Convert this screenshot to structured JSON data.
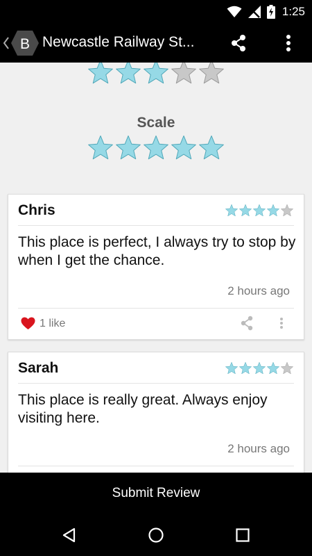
{
  "status_bar": {
    "time": "1:25",
    "icons": [
      "wifi-icon",
      "signal-icon",
      "battery-charging-icon"
    ]
  },
  "app_bar": {
    "logo_letter": "B",
    "title": "Newcastle Railway St...",
    "icons": [
      "back-chevron-icon",
      "share-icon",
      "more-vert-icon"
    ]
  },
  "ratings": {
    "top_rating": {
      "value": 3,
      "max": 5
    },
    "scale": {
      "label": "Scale",
      "value": 5,
      "max": 5
    }
  },
  "reviews": [
    {
      "name": "Chris",
      "rating": 4,
      "max_rating": 5,
      "text": "This place is perfect, I always try to stop by when I get the chance.",
      "time": "2 hours ago",
      "likes": "1 like"
    },
    {
      "name": "Sarah",
      "rating": 4,
      "max_rating": 5,
      "text": "This place is really great. Always enjoy visiting here.",
      "time": "2 hours ago"
    }
  ],
  "submit_button": {
    "label": "Submit Review"
  },
  "nav_bar": {
    "icons": [
      "back-triangle-icon",
      "home-circle-icon",
      "recents-square-icon"
    ]
  },
  "colors": {
    "star_filled": "#96d9e6",
    "star_filled_stroke": "#4fa7b8",
    "star_empty": "#c8c8c8",
    "heart": "#d9151e",
    "bar_bg": "#000000",
    "content_bg": "#f0f0f0"
  }
}
